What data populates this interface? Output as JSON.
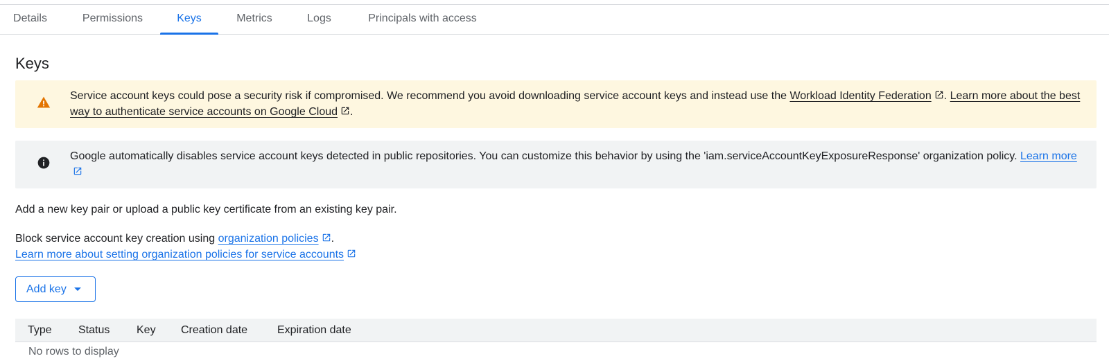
{
  "tabs": [
    {
      "label": "Details",
      "active": false
    },
    {
      "label": "Permissions",
      "active": false
    },
    {
      "label": "Keys",
      "active": true
    },
    {
      "label": "Metrics",
      "active": false
    },
    {
      "label": "Logs",
      "active": false
    },
    {
      "label": "Principals with access",
      "active": false
    }
  ],
  "page_title": "Keys",
  "warning_banner": {
    "icon": "warning-icon",
    "text_before": "Service account keys could pose a security risk if compromised. We recommend you avoid downloading service account keys and instead use the ",
    "link1": "Workload Identity Federation",
    "sep": ". ",
    "link2": "Learn more about the best way to authenticate service accounts on Google Cloud",
    "text_after": ".",
    "color": "#fef7e0",
    "icon_color": "#e37400"
  },
  "info_banner": {
    "icon": "info-icon",
    "text_before": "Google automatically disables service account keys detected in public repositories. You can customize this behavior by using the 'iam.serviceAccountKeyExposureResponse' organization policy. ",
    "link": "Learn more",
    "color": "#f1f3f4"
  },
  "intro_text": "Add a new key pair or upload a public key certificate from an existing key pair.",
  "block_text_before": "Block service account key creation using ",
  "block_link": "organization policies",
  "block_text_after": ".",
  "learn_more_link": "Learn more about setting organization policies for service accounts",
  "add_key_button": "Add key",
  "table": {
    "columns": [
      "Type",
      "Status",
      "Key",
      "Creation date",
      "Expiration date"
    ],
    "empty_message": "No rows to display"
  },
  "colors": {
    "accent": "#1a73e8",
    "text": "#202124",
    "muted": "#5f6368"
  }
}
